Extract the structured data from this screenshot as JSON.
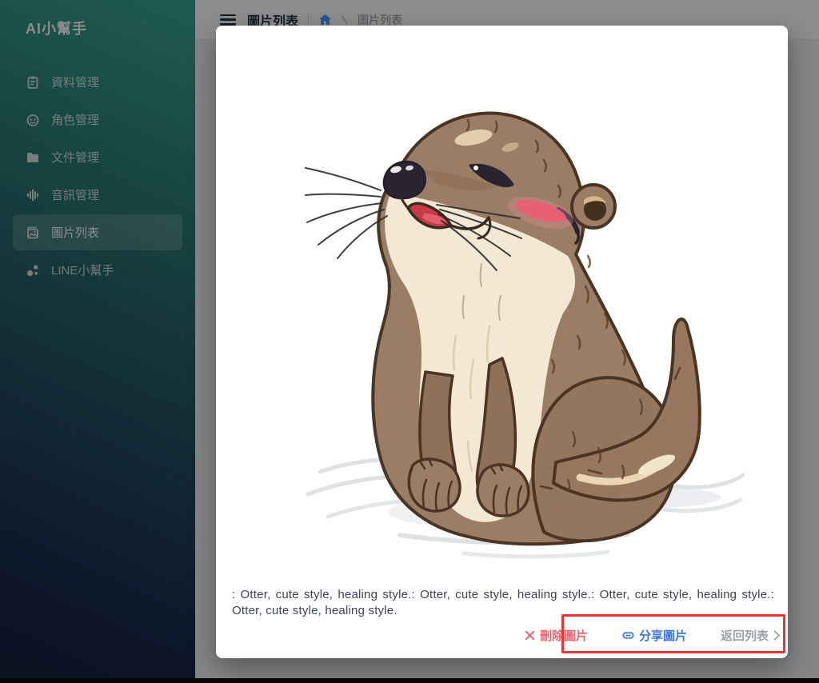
{
  "sidebar": {
    "title": "AI小幫手",
    "active_index": 4,
    "items": [
      {
        "label": "資料管理",
        "icon": "clipboard-icon"
      },
      {
        "label": "角色管理",
        "icon": "robot-face-icon"
      },
      {
        "label": "文件管理",
        "icon": "folder-icon"
      },
      {
        "label": "音訊管理",
        "icon": "audio-bars-icon"
      },
      {
        "label": "圖片列表",
        "icon": "image-icon"
      },
      {
        "label": "LINE小幫手",
        "icon": "share-dots-icon"
      }
    ]
  },
  "header": {
    "title": "圖片列表",
    "breadcrumb_current": "圖片列表"
  },
  "modal": {
    "image_subject": "otter-illustration",
    "description": ": Otter, cute style, healing style.: Otter, cute style, healing style.: Otter, cute style, healing style.: Otter, cute style, healing style.",
    "actions": {
      "delete": "刪除圖片",
      "share": "分享圖片",
      "back": "返回列表"
    }
  },
  "colors": {
    "sidebar_gradient_top": "#3aa791",
    "sidebar_gradient_bottom": "#151f3a",
    "danger": "#f0616d",
    "primary": "#3d77dd",
    "muted": "#9ba1ab",
    "annotation_red": "#e43636",
    "home_icon_blue": "#409eff",
    "overlay": "rgba(0,0,0,0.45)"
  }
}
